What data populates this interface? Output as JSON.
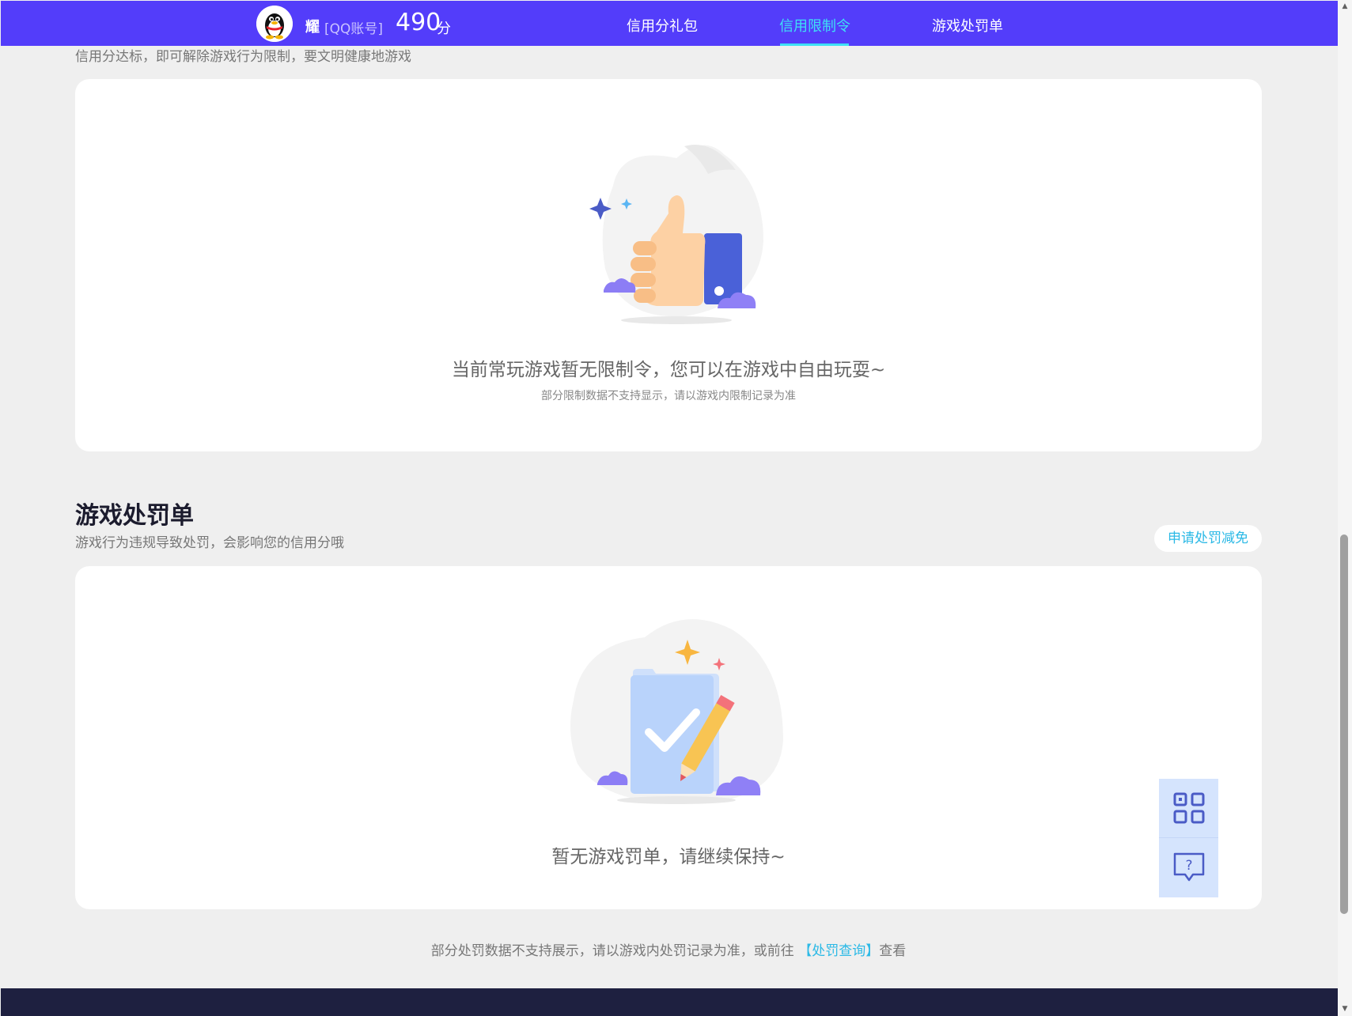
{
  "header": {
    "nickname": "耀",
    "account_type": "[QQ账号]",
    "score": "490",
    "score_unit": "分",
    "nav": [
      {
        "label": "信用分礼包",
        "active": false
      },
      {
        "label": "信用限制令",
        "active": true
      },
      {
        "label": "游戏处罚单",
        "active": false
      }
    ]
  },
  "restriction": {
    "subtitle": "信用分达标，即可解除游戏行为限制，要文明健康地游戏",
    "empty_title": "当前常玩游戏暂无限制令，您可以在游戏中自由玩耍~",
    "empty_note": "部分限制数据不支持显示，请以游戏内限制记录为准"
  },
  "penalty": {
    "title": "游戏处罚单",
    "subtitle": "游戏行为违规导致处罚，会影响您的信用分哦",
    "apply_button": "申请处罚减免",
    "empty_title": "暂无游戏罚单，请继续保持~"
  },
  "footer": {
    "note_prefix": "部分处罚数据不支持展示，请以游戏内处罚记录为准，或前往",
    "link": "【处罚查询】",
    "note_suffix": "查看"
  },
  "floating": [
    {
      "icon": "qr-code-icon"
    },
    {
      "icon": "help-chat-icon"
    }
  ],
  "colors": {
    "header_bg": "#533dfa",
    "accent": "#3ee0f5",
    "link": "#2bb9e6",
    "bottom_bar": "#1e2040"
  }
}
